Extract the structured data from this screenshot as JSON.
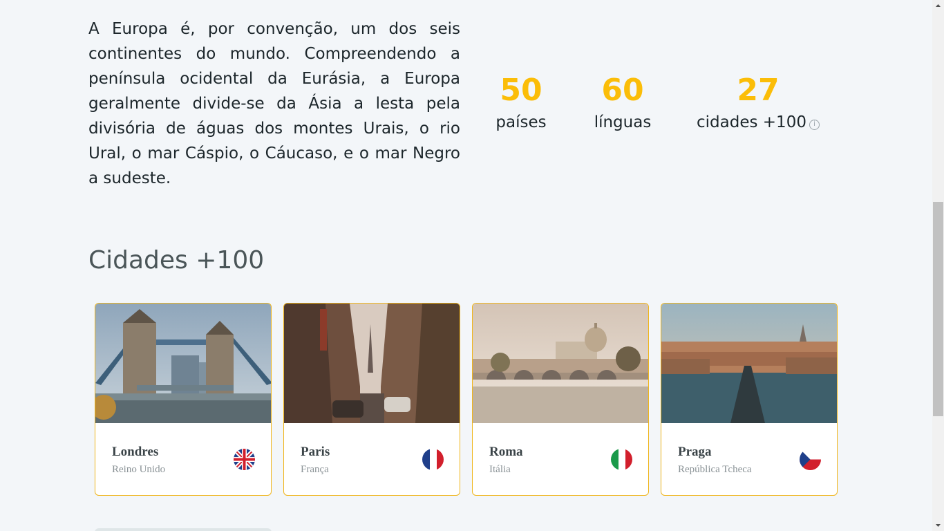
{
  "intro": {
    "text": "A Europa é, por convenção, um dos seis continentes do mundo. Compreendendo a península ocidental da Eurásia, a Europa geralmente divide-se da Ásia a lesta pela divisória de águas dos montes Urais, o rio Ural, o mar Cáspio, o Cáucaso, e o mar Negro a sudeste."
  },
  "stats": [
    {
      "number": "50",
      "label": "países"
    },
    {
      "number": "60",
      "label": "línguas"
    },
    {
      "number": "27",
      "label": "cidades +100",
      "info_icon": "info-icon"
    }
  ],
  "section": {
    "title": "Cidades +100"
  },
  "cities": [
    {
      "name": "Londres",
      "country": "Reino Unido",
      "flag_icon": "uk-flag-icon"
    },
    {
      "name": "Paris",
      "country": "França",
      "flag_icon": "france-flag-icon"
    },
    {
      "name": "Roma",
      "country": "Itália",
      "flag_icon": "italy-flag-icon"
    },
    {
      "name": "Praga",
      "country": "República Tcheca",
      "flag_icon": "czech-flag-icon"
    }
  ],
  "colors": {
    "accent": "#fbbd08",
    "card_border": "#f0b51a",
    "background": "#f3f6f9",
    "title": "#4a5558"
  }
}
